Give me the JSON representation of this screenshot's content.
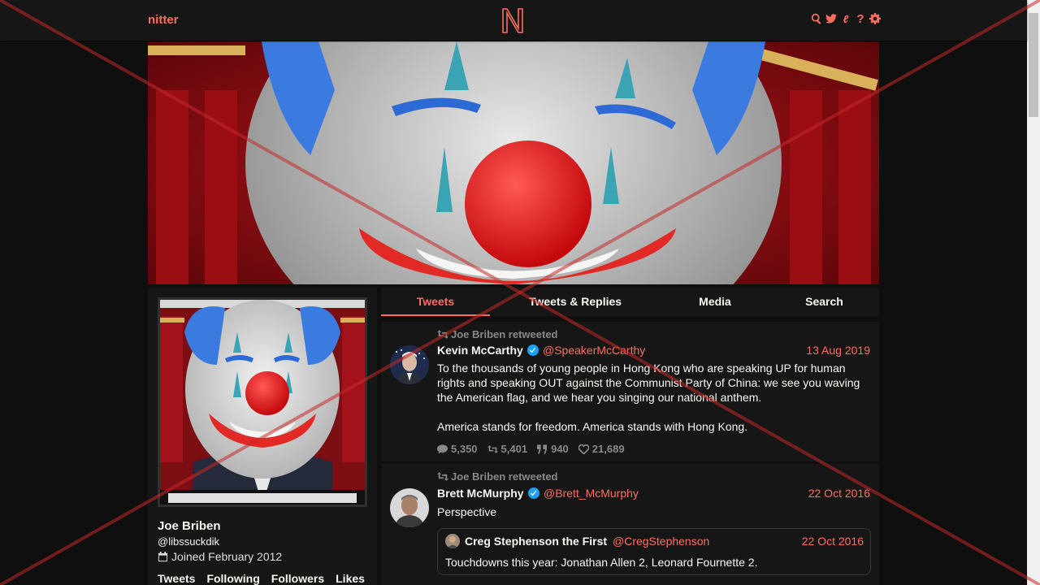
{
  "nav": {
    "brand": "nitter",
    "logo_letter": "N",
    "icons": [
      "search-icon",
      "twitter-icon",
      "rss-icon",
      "help-icon",
      "settings-icon"
    ],
    "help_glyph": "?",
    "rss_glyph": "ℓ"
  },
  "profile": {
    "fullname": "Joe Briben",
    "username": "@libssuckdik",
    "joined": "Joined February 2012",
    "stats": [
      "Tweets",
      "Following",
      "Followers",
      "Likes"
    ]
  },
  "tabs": [
    "Tweets",
    "Tweets & Replies",
    "Media",
    "Search"
  ],
  "tweets": [
    {
      "retweet_header": "Joe Briben retweeted",
      "fullname": "Kevin McCarthy",
      "handle": "@SpeakerMcCarthy",
      "date": "13 Aug 2019",
      "paragraphs": [
        "To the thousands of young people in Hong Kong who are speaking UP for human rights and speaking OUT against the Communist Party of China: we see you waving the American flag, and we hear you singing our national anthem.",
        "America stands for freedom. America stands with Hong Kong."
      ],
      "stats": {
        "replies": "5,350",
        "retweets": "5,401",
        "quotes": "940",
        "likes": "21,689"
      }
    },
    {
      "retweet_header": "Joe Briben retweeted",
      "fullname": "Brett McMurphy",
      "handle": "@Brett_McMurphy",
      "date": "22 Oct 2016",
      "paragraphs": [
        "Perspective"
      ],
      "quote": {
        "fullname": "Creg Stephenson the First",
        "handle": "@CregStephenson",
        "date": "22 Oct 2016",
        "text": "Touchdowns this year: Jonathan Allen 2, Leonard Fournette 2."
      }
    }
  ],
  "colors": {
    "accent": "#ff6c60",
    "background": "#0f0f0f",
    "panel": "#161616",
    "text": "#f8f8f2",
    "muted": "#888889",
    "verified": "#1da1f2",
    "overlay_cross": "#c62828"
  }
}
